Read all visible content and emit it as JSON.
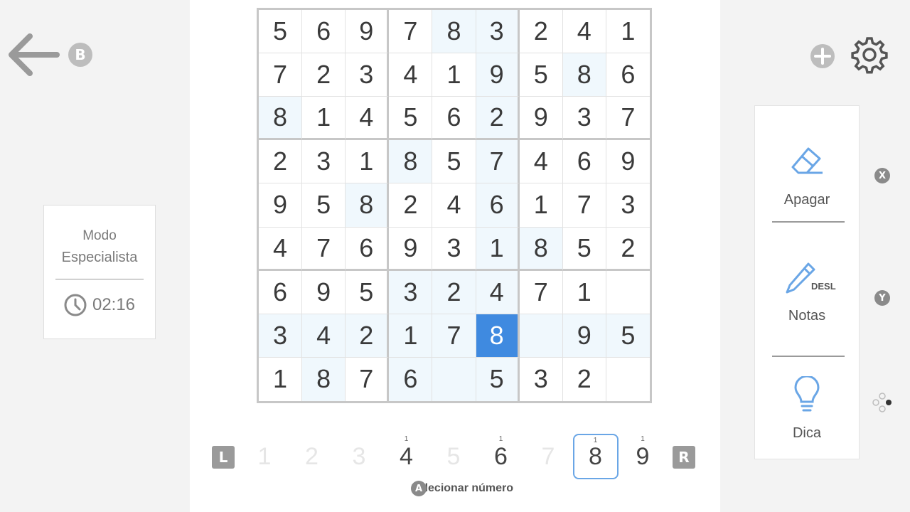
{
  "buttons": {
    "back_badge": "B",
    "x_badge": "X",
    "y_badge": "Y",
    "a_badge": "A",
    "l_badge": "L",
    "r_badge": "R"
  },
  "mode": {
    "line1": "Modo",
    "line2": "Especialista",
    "timer": "02:16"
  },
  "grid": {
    "rows": [
      [
        "5",
        "6",
        "9",
        "7",
        "8",
        "3",
        "2",
        "4",
        "1"
      ],
      [
        "7",
        "2",
        "3",
        "4",
        "1",
        "9",
        "5",
        "8",
        "6"
      ],
      [
        "8",
        "1",
        "4",
        "5",
        "6",
        "2",
        "9",
        "3",
        "7"
      ],
      [
        "2",
        "3",
        "1",
        "8",
        "5",
        "7",
        "4",
        "6",
        "9"
      ],
      [
        "9",
        "5",
        "8",
        "2",
        "4",
        "6",
        "1",
        "7",
        "3"
      ],
      [
        "4",
        "7",
        "6",
        "9",
        "3",
        "1",
        "8",
        "5",
        "2"
      ],
      [
        "6",
        "9",
        "5",
        "3",
        "2",
        "4",
        "7",
        "1",
        ""
      ],
      [
        "3",
        "4",
        "2",
        "1",
        "7",
        "8",
        "",
        "9",
        "5"
      ],
      [
        "1",
        "8",
        "7",
        "6",
        "",
        "5",
        "3",
        "2",
        ""
      ]
    ],
    "selected_cell": [
      7,
      5
    ],
    "highlight_color": "#f0f8fd",
    "selected_color": "#3f8ae0"
  },
  "number_bar": {
    "numbers": [
      "1",
      "2",
      "3",
      "4",
      "5",
      "6",
      "7",
      "8",
      "9"
    ],
    "remaining": [
      "",
      "",
      "",
      "1",
      "",
      "1",
      "",
      "1",
      "1"
    ],
    "selected": "8",
    "hint": "Selecionar número"
  },
  "tools": {
    "erase": "Apagar",
    "notes": "Notas",
    "notes_state": "DESL",
    "hint": "Dica"
  },
  "icons": {
    "back": "arrow-left-icon",
    "add": "plus-circle-icon",
    "settings": "gear-icon",
    "erase": "eraser-icon",
    "notes": "pencil-icon",
    "hint": "lightbulb-icon",
    "clock": "clock-icon",
    "more": "dots-icon"
  },
  "colors": {
    "accent": "#3f8ae0",
    "tool_icon": "#6aa6e6"
  }
}
